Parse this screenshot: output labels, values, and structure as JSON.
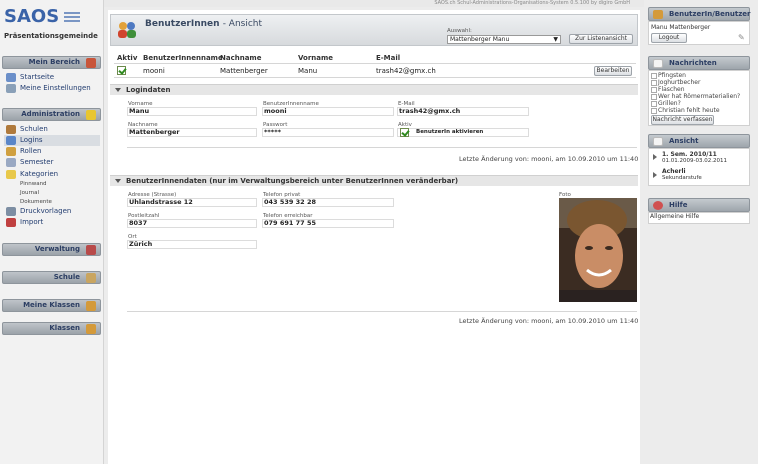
{
  "app": {
    "credit": "SAOS.ch Schul-Administrations-Organisations-System 0.5.100 by digiro GmbH",
    "logo": "SAOS",
    "school": "Präsentationsgemeinde"
  },
  "left": {
    "mein_bereich": "Mein Bereich",
    "mein_items": [
      "Startseite",
      "Meine Einstellungen"
    ],
    "administration": "Administration",
    "admin_items": [
      "Schulen",
      "Logins",
      "Rollen",
      "Semester",
      "Kategorien"
    ],
    "kategorien_sub": [
      "Pinnwand",
      "Journal",
      "Dokumente"
    ],
    "admin_items2": [
      "Druckvorlagen",
      "Import"
    ],
    "verwaltung": "Verwaltung",
    "schule": "Schule",
    "meine_klassen": "Meine Klassen",
    "klassen": "Klassen"
  },
  "header": {
    "title": "BenutzerInnen",
    "subtitle": "- Ansicht",
    "auswahl_label": "Auswahl:",
    "auswahl_value": "Mattenberger Manu",
    "list_button": "Zur Listenansicht"
  },
  "table": {
    "columns": [
      "Aktiv",
      "BenutzerInnenname",
      "Nachname",
      "Vorname",
      "E-Mail"
    ],
    "row": {
      "username": "mooni",
      "nachname": "Mattenberger",
      "vorname": "Manu",
      "email": "trash42@gmx.ch"
    },
    "edit_button": "Bearbeiten"
  },
  "logindaten": {
    "title": "Logindaten",
    "vorname_label": "Vorname",
    "vorname": "Manu",
    "username_label": "BenutzerInnenname",
    "username": "mooni",
    "email_label": "E-Mail",
    "email": "trash42@gmx.ch",
    "nachname_label": "Nachname",
    "nachname": "Mattenberger",
    "passwort_label": "Passwort",
    "passwort": "*****",
    "aktiv_label": "Aktiv",
    "aktiv_text": "BenutzerIn aktivieren",
    "last_change": "Letzte Änderung von: mooni, am 10.09.2010 um 11:40"
  },
  "benutzerdaten": {
    "title": "BenutzerInnendaten (nur im Verwaltungsbereich unter BenutzerInnen veränderbar)",
    "adresse_label": "Adresse (Strasse)",
    "adresse": "Uhlandstrasse 12",
    "tel_privat_label": "Telefon privat",
    "tel_privat": "043 539 32 28",
    "plz_label": "Postleitzahl",
    "plz": "8037",
    "tel_erreichbar_label": "Telefon erreichbar",
    "tel_erreichbar": "079 691 77 55",
    "ort_label": "Ort",
    "ort": "Zürich",
    "foto_label": "Foto",
    "last_change": "Letzte Änderung von: mooni, am 10.09.2010 um 11:40"
  },
  "right": {
    "benutzer_head": "BenutzerIn/Benutzer",
    "benutzer_name": "Manu Mattenberger",
    "logout": "Logout",
    "nachrichten_head": "Nachrichten",
    "messages": [
      "Pfingsten",
      "Joghurtbecher",
      "Flaschen",
      "Wer hat Römermaterialien?",
      "Grillen?",
      "Christian fehlt heute"
    ],
    "verfassen": "Nachricht verfassen",
    "ansicht_head": "Ansicht",
    "semester": "1. Sem. 2010/11",
    "semester_dates": "01.01.2009-03.02.2011",
    "class_name": "Acherli",
    "class_level": "Sekundarstufe",
    "hilfe_head": "Hilfe",
    "hilfe_item": "Allgemeine Hilfe"
  },
  "colors": {
    "accent": "#3a63a8",
    "header_gray": "#9ea5ac",
    "check_green": "#2e8a1e"
  }
}
